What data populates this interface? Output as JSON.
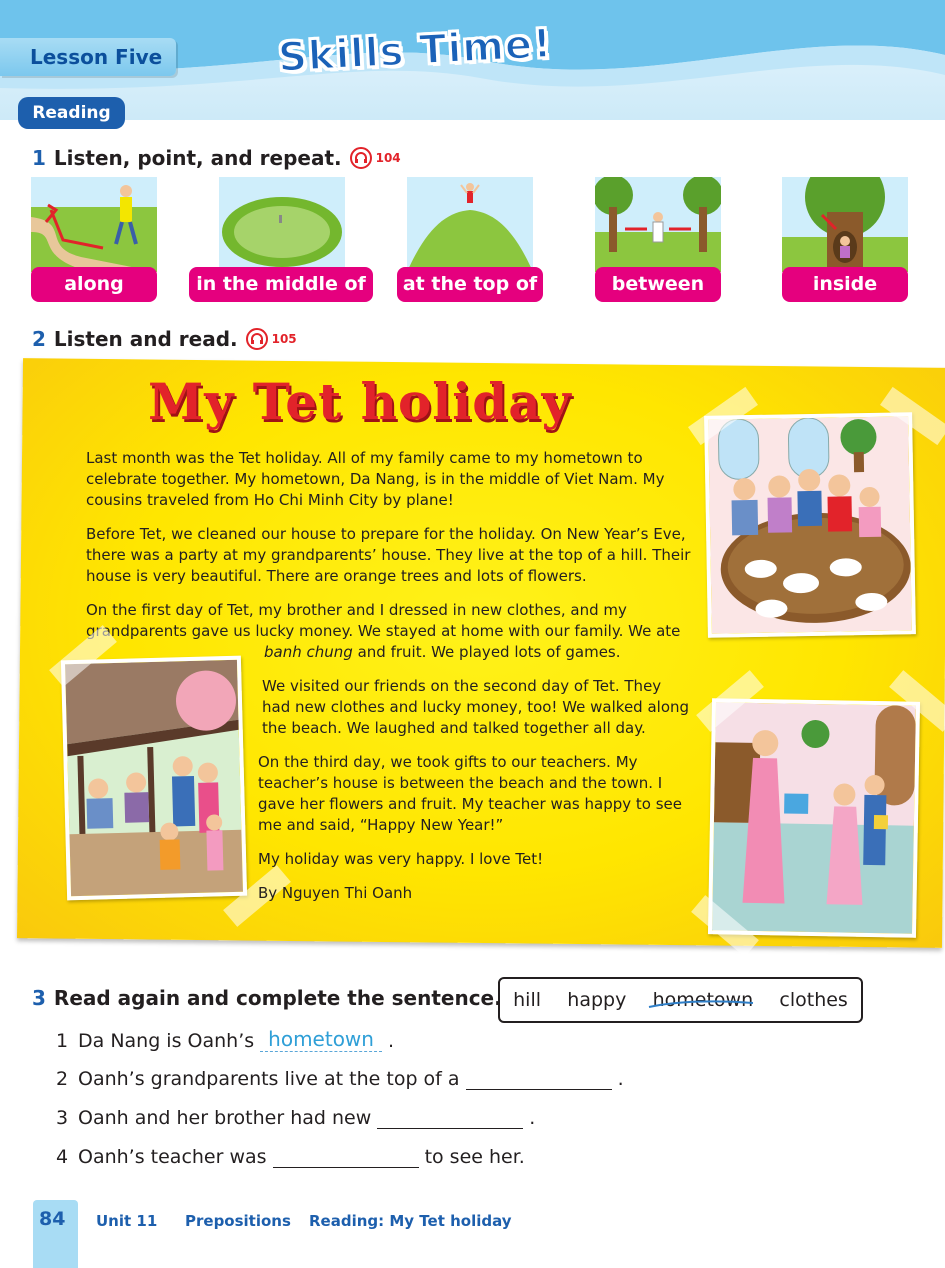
{
  "header": {
    "lesson_tab": "Lesson Five",
    "title": "Skills Time!",
    "section_pill": "Reading"
  },
  "exercise1": {
    "number": "1",
    "instruction": "Listen, point, and repeat.",
    "audio_track": "104",
    "cards": [
      {
        "label": "along"
      },
      {
        "label": "in the middle of"
      },
      {
        "label": "at the top of"
      },
      {
        "label": "between"
      },
      {
        "label": "inside"
      }
    ]
  },
  "exercise2": {
    "number": "2",
    "instruction": "Listen and read.",
    "audio_track": "105",
    "story_title": "My Tet holiday",
    "paragraphs": {
      "p1": "Last month was the Tet holiday. All of my family came to my hometown to celebrate together. My hometown, Da Nang, is in the middle of Viet Nam. My cousins traveled from Ho Chi Minh City by plane!",
      "p2": "Before Tet, we cleaned our house to prepare for the holiday. On New Year’s Eve, there was a party at my grandparents’ house. They live at the top of a hill. Their house is very beautiful. There are orange trees and lots of flowers.",
      "p3_a": "On the first day of Tet, my brother and I dressed in new clothes, and my grandparents gave us lucky money. We stayed at home with our family. We ate",
      "p3_italic": "banh chung",
      "p3_b": "and fruit. We played lots of games.",
      "p4": "We visited our friends on the second day of Tet. They had new clothes and lucky money, too! We walked along the beach. We laughed and talked together all day.",
      "p5": "On the third day, we took gifts to our teachers. My teacher’s house is between the beach and the town. I gave her flowers and fruit. My teacher was happy to see me and said, “Happy New Year!”",
      "p6": "My holiday was very happy. I love Tet!",
      "byline": "By Nguyen Thi Oanh"
    }
  },
  "exercise3": {
    "number": "3",
    "instruction": "Read again and complete the sentence.",
    "word_bank": [
      "hill",
      "happy",
      "hometown",
      "clothes"
    ],
    "questions": [
      {
        "num": "1",
        "before": "Da Nang is Oanh’s",
        "answer": "hometown",
        "after": "."
      },
      {
        "num": "2",
        "before": "Oanh’s grandparents live at the top of a",
        "answer": "",
        "after": "."
      },
      {
        "num": "3",
        "before": "Oanh and her brother had new",
        "answer": "",
        "after": "."
      },
      {
        "num": "4",
        "before": "Oanh’s teacher was",
        "answer": "",
        "after": "to see her."
      }
    ]
  },
  "footer": {
    "page_number": "84",
    "unit": "Unit 11",
    "topic": "Prepositions",
    "lesson": "Reading: My Tet holiday"
  },
  "colors": {
    "brand_blue": "#1d5fad",
    "card_magenta": "#e5007e",
    "title_red": "#e2232a",
    "panel_yellow": "#ffe600",
    "answer_blue": "#2f9fd7"
  },
  "icons": [
    "headphones-icon",
    "strike-through-mark"
  ]
}
